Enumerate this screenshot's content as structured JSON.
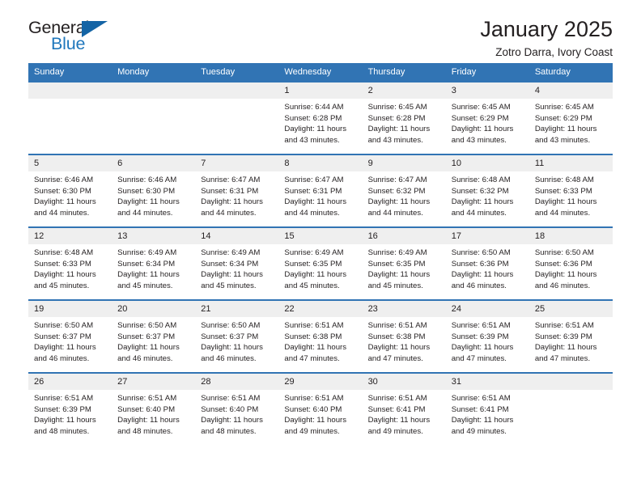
{
  "brand": {
    "name_top": "General",
    "name_bottom": "Blue",
    "accent_color": "#1f77bc",
    "triangle_color": "#1464a5"
  },
  "header": {
    "title": "January 2025",
    "subtitle": "Zotro Darra, Ivory Coast"
  },
  "theme": {
    "header_row_bg": "#3174b4",
    "daynum_bg": "#efefef",
    "text_color": "#231f20"
  },
  "calendar": {
    "weekday_headers": [
      "Sunday",
      "Monday",
      "Tuesday",
      "Wednesday",
      "Thursday",
      "Friday",
      "Saturday"
    ],
    "labels": {
      "sunrise": "Sunrise:",
      "sunset": "Sunset:",
      "daylight": "Daylight:"
    },
    "weeks": [
      [
        {
          "day": "",
          "sunrise": "",
          "sunset": "",
          "daylight_line1": "",
          "daylight_line2": ""
        },
        {
          "day": "",
          "sunrise": "",
          "sunset": "",
          "daylight_line1": "",
          "daylight_line2": ""
        },
        {
          "day": "",
          "sunrise": "",
          "sunset": "",
          "daylight_line1": "",
          "daylight_line2": ""
        },
        {
          "day": "1",
          "sunrise": "Sunrise: 6:44 AM",
          "sunset": "Sunset: 6:28 PM",
          "daylight_line1": "Daylight: 11 hours",
          "daylight_line2": "and 43 minutes."
        },
        {
          "day": "2",
          "sunrise": "Sunrise: 6:45 AM",
          "sunset": "Sunset: 6:28 PM",
          "daylight_line1": "Daylight: 11 hours",
          "daylight_line2": "and 43 minutes."
        },
        {
          "day": "3",
          "sunrise": "Sunrise: 6:45 AM",
          "sunset": "Sunset: 6:29 PM",
          "daylight_line1": "Daylight: 11 hours",
          "daylight_line2": "and 43 minutes."
        },
        {
          "day": "4",
          "sunrise": "Sunrise: 6:45 AM",
          "sunset": "Sunset: 6:29 PM",
          "daylight_line1": "Daylight: 11 hours",
          "daylight_line2": "and 43 minutes."
        }
      ],
      [
        {
          "day": "5",
          "sunrise": "Sunrise: 6:46 AM",
          "sunset": "Sunset: 6:30 PM",
          "daylight_line1": "Daylight: 11 hours",
          "daylight_line2": "and 44 minutes."
        },
        {
          "day": "6",
          "sunrise": "Sunrise: 6:46 AM",
          "sunset": "Sunset: 6:30 PM",
          "daylight_line1": "Daylight: 11 hours",
          "daylight_line2": "and 44 minutes."
        },
        {
          "day": "7",
          "sunrise": "Sunrise: 6:47 AM",
          "sunset": "Sunset: 6:31 PM",
          "daylight_line1": "Daylight: 11 hours",
          "daylight_line2": "and 44 minutes."
        },
        {
          "day": "8",
          "sunrise": "Sunrise: 6:47 AM",
          "sunset": "Sunset: 6:31 PM",
          "daylight_line1": "Daylight: 11 hours",
          "daylight_line2": "and 44 minutes."
        },
        {
          "day": "9",
          "sunrise": "Sunrise: 6:47 AM",
          "sunset": "Sunset: 6:32 PM",
          "daylight_line1": "Daylight: 11 hours",
          "daylight_line2": "and 44 minutes."
        },
        {
          "day": "10",
          "sunrise": "Sunrise: 6:48 AM",
          "sunset": "Sunset: 6:32 PM",
          "daylight_line1": "Daylight: 11 hours",
          "daylight_line2": "and 44 minutes."
        },
        {
          "day": "11",
          "sunrise": "Sunrise: 6:48 AM",
          "sunset": "Sunset: 6:33 PM",
          "daylight_line1": "Daylight: 11 hours",
          "daylight_line2": "and 44 minutes."
        }
      ],
      [
        {
          "day": "12",
          "sunrise": "Sunrise: 6:48 AM",
          "sunset": "Sunset: 6:33 PM",
          "daylight_line1": "Daylight: 11 hours",
          "daylight_line2": "and 45 minutes."
        },
        {
          "day": "13",
          "sunrise": "Sunrise: 6:49 AM",
          "sunset": "Sunset: 6:34 PM",
          "daylight_line1": "Daylight: 11 hours",
          "daylight_line2": "and 45 minutes."
        },
        {
          "day": "14",
          "sunrise": "Sunrise: 6:49 AM",
          "sunset": "Sunset: 6:34 PM",
          "daylight_line1": "Daylight: 11 hours",
          "daylight_line2": "and 45 minutes."
        },
        {
          "day": "15",
          "sunrise": "Sunrise: 6:49 AM",
          "sunset": "Sunset: 6:35 PM",
          "daylight_line1": "Daylight: 11 hours",
          "daylight_line2": "and 45 minutes."
        },
        {
          "day": "16",
          "sunrise": "Sunrise: 6:49 AM",
          "sunset": "Sunset: 6:35 PM",
          "daylight_line1": "Daylight: 11 hours",
          "daylight_line2": "and 45 minutes."
        },
        {
          "day": "17",
          "sunrise": "Sunrise: 6:50 AM",
          "sunset": "Sunset: 6:36 PM",
          "daylight_line1": "Daylight: 11 hours",
          "daylight_line2": "and 46 minutes."
        },
        {
          "day": "18",
          "sunrise": "Sunrise: 6:50 AM",
          "sunset": "Sunset: 6:36 PM",
          "daylight_line1": "Daylight: 11 hours",
          "daylight_line2": "and 46 minutes."
        }
      ],
      [
        {
          "day": "19",
          "sunrise": "Sunrise: 6:50 AM",
          "sunset": "Sunset: 6:37 PM",
          "daylight_line1": "Daylight: 11 hours",
          "daylight_line2": "and 46 minutes."
        },
        {
          "day": "20",
          "sunrise": "Sunrise: 6:50 AM",
          "sunset": "Sunset: 6:37 PM",
          "daylight_line1": "Daylight: 11 hours",
          "daylight_line2": "and 46 minutes."
        },
        {
          "day": "21",
          "sunrise": "Sunrise: 6:50 AM",
          "sunset": "Sunset: 6:37 PM",
          "daylight_line1": "Daylight: 11 hours",
          "daylight_line2": "and 46 minutes."
        },
        {
          "day": "22",
          "sunrise": "Sunrise: 6:51 AM",
          "sunset": "Sunset: 6:38 PM",
          "daylight_line1": "Daylight: 11 hours",
          "daylight_line2": "and 47 minutes."
        },
        {
          "day": "23",
          "sunrise": "Sunrise: 6:51 AM",
          "sunset": "Sunset: 6:38 PM",
          "daylight_line1": "Daylight: 11 hours",
          "daylight_line2": "and 47 minutes."
        },
        {
          "day": "24",
          "sunrise": "Sunrise: 6:51 AM",
          "sunset": "Sunset: 6:39 PM",
          "daylight_line1": "Daylight: 11 hours",
          "daylight_line2": "and 47 minutes."
        },
        {
          "day": "25",
          "sunrise": "Sunrise: 6:51 AM",
          "sunset": "Sunset: 6:39 PM",
          "daylight_line1": "Daylight: 11 hours",
          "daylight_line2": "and 47 minutes."
        }
      ],
      [
        {
          "day": "26",
          "sunrise": "Sunrise: 6:51 AM",
          "sunset": "Sunset: 6:39 PM",
          "daylight_line1": "Daylight: 11 hours",
          "daylight_line2": "and 48 minutes."
        },
        {
          "day": "27",
          "sunrise": "Sunrise: 6:51 AM",
          "sunset": "Sunset: 6:40 PM",
          "daylight_line1": "Daylight: 11 hours",
          "daylight_line2": "and 48 minutes."
        },
        {
          "day": "28",
          "sunrise": "Sunrise: 6:51 AM",
          "sunset": "Sunset: 6:40 PM",
          "daylight_line1": "Daylight: 11 hours",
          "daylight_line2": "and 48 minutes."
        },
        {
          "day": "29",
          "sunrise": "Sunrise: 6:51 AM",
          "sunset": "Sunset: 6:40 PM",
          "daylight_line1": "Daylight: 11 hours",
          "daylight_line2": "and 49 minutes."
        },
        {
          "day": "30",
          "sunrise": "Sunrise: 6:51 AM",
          "sunset": "Sunset: 6:41 PM",
          "daylight_line1": "Daylight: 11 hours",
          "daylight_line2": "and 49 minutes."
        },
        {
          "day": "31",
          "sunrise": "Sunrise: 6:51 AM",
          "sunset": "Sunset: 6:41 PM",
          "daylight_line1": "Daylight: 11 hours",
          "daylight_line2": "and 49 minutes."
        },
        {
          "day": "",
          "sunrise": "",
          "sunset": "",
          "daylight_line1": "",
          "daylight_line2": ""
        }
      ]
    ]
  }
}
